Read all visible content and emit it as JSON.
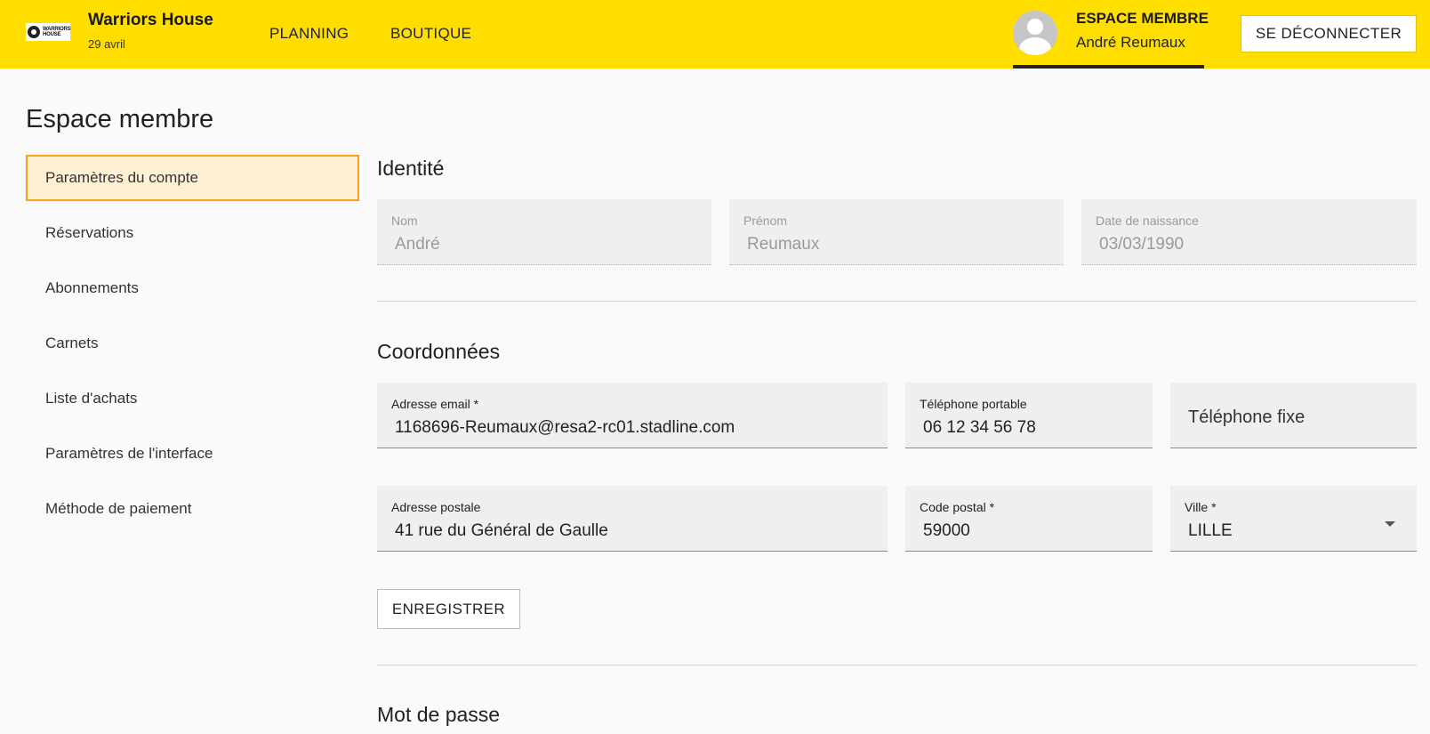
{
  "header": {
    "logo_text": "WARRIORS HOUSE",
    "brand_name": "Warriors House",
    "date": "29 avril",
    "nav": [
      {
        "label": "PLANNING"
      },
      {
        "label": "BOUTIQUE"
      }
    ],
    "member_title": "ESPACE MEMBRE",
    "member_name": "André Reumaux",
    "logout_label": "SE DÉCONNECTER",
    "accent_color": "#ffde00"
  },
  "page_title": "Espace membre",
  "sidebar": {
    "items": [
      {
        "label": "Paramètres du compte",
        "active": true
      },
      {
        "label": "Réservations"
      },
      {
        "label": "Abonnements"
      },
      {
        "label": "Carnets"
      },
      {
        "label": "Liste d'achats"
      },
      {
        "label": "Paramètres de l'interface"
      },
      {
        "label": "Méthode de paiement"
      }
    ],
    "active_color": "#f7a21b"
  },
  "identity": {
    "title": "Identité",
    "nom": {
      "label": "Nom",
      "value": "André"
    },
    "prenom": {
      "label": "Prénom",
      "value": "Reumaux"
    },
    "birthdate": {
      "label": "Date de naissance",
      "value": "03/03/1990"
    }
  },
  "contact": {
    "title": "Coordonnées",
    "email": {
      "label": "Adresse email *",
      "value": "1168696-Reumaux@resa2-rc01.stadline.com"
    },
    "mobile": {
      "label": "Téléphone portable",
      "value": "06 12 34 56 78"
    },
    "landline": {
      "placeholder": "Téléphone fixe"
    },
    "address": {
      "label": "Adresse postale",
      "value": "41 rue du Général de Gaulle"
    },
    "postal_code": {
      "label": "Code postal *",
      "value": "59000"
    },
    "city": {
      "label": "Ville *",
      "value": "LILLE"
    }
  },
  "save_label": "ENREGISTRER",
  "password": {
    "title": "Mot de passe"
  }
}
